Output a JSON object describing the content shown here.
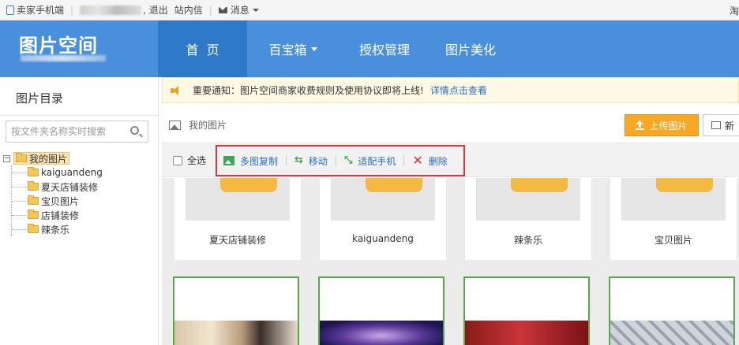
{
  "topbar": {
    "seller_mobile": "卖家手机端",
    "logout": ", 退出",
    "inbox": "站内信",
    "messages": "消息",
    "right_cut": "淘"
  },
  "header": {
    "logo": "图片空间",
    "nav": [
      {
        "label": "首  页",
        "active": true
      },
      {
        "label": "百宝箱",
        "dropdown": true
      },
      {
        "label": "授权管理"
      },
      {
        "label": "图片美化"
      }
    ]
  },
  "sidebar": {
    "title": "图片目录",
    "search_placeholder": "按文件夹名称实时搜索",
    "tree_toggle": "−",
    "root": "我的图片",
    "children": [
      "kaiguandeng",
      "夏天店铺装修",
      "宝贝图片",
      "店铺装修",
      "辣条乐"
    ]
  },
  "notice": {
    "text": "重要通知：图片空间商家收费规则及使用协议即将上线!",
    "link": "详情点击查看"
  },
  "main": {
    "breadcrumb": "我的图片",
    "upload_label": "上传图片",
    "new_label": "新",
    "select_all": "全选",
    "actions": {
      "copy": "多图复制",
      "move": "移动",
      "fit_mobile": "适配手机",
      "delete": "删除"
    },
    "folders": [
      "夏天店铺装修",
      "kaiguandeng",
      "辣条乐",
      "宝贝图片"
    ]
  },
  "colors": {
    "header_blue": "#4a8fdb",
    "nav_active": "#2f79c9",
    "upload_orange": "#f9a825",
    "highlight_red": "#e3333a",
    "link_blue": "#2a6fc0"
  }
}
